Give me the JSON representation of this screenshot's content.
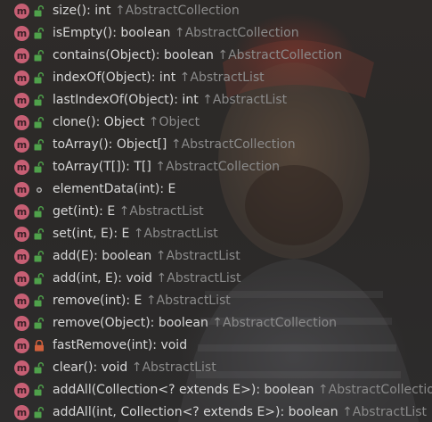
{
  "colors": {
    "method_icon": "#c75f74",
    "public_lock": "#4fa14b",
    "private_lock": "#d0603c",
    "text": "#d7d7d7",
    "origin_text": "#8a8a8a"
  },
  "members": [
    {
      "kind_letter": "m",
      "access": "public",
      "access_icon": "unlocked-icon",
      "signature": "size(): int",
      "origin": "↑AbstractCollection"
    },
    {
      "kind_letter": "m",
      "access": "public",
      "access_icon": "unlocked-icon",
      "signature": "isEmpty(): boolean",
      "origin": "↑AbstractCollection"
    },
    {
      "kind_letter": "m",
      "access": "public",
      "access_icon": "unlocked-icon",
      "signature": "contains(Object): boolean",
      "origin": "↑AbstractCollection"
    },
    {
      "kind_letter": "m",
      "access": "public",
      "access_icon": "unlocked-icon",
      "signature": "indexOf(Object): int",
      "origin": "↑AbstractList"
    },
    {
      "kind_letter": "m",
      "access": "public",
      "access_icon": "unlocked-icon",
      "signature": "lastIndexOf(Object): int",
      "origin": "↑AbstractList"
    },
    {
      "kind_letter": "m",
      "access": "public",
      "access_icon": "unlocked-icon",
      "signature": "clone(): Object",
      "origin": "↑Object"
    },
    {
      "kind_letter": "m",
      "access": "public",
      "access_icon": "unlocked-icon",
      "signature": "toArray(): Object[]",
      "origin": "↑AbstractCollection"
    },
    {
      "kind_letter": "m",
      "access": "public",
      "access_icon": "unlocked-icon",
      "signature": "toArray(T[]): T[]",
      "origin": "↑AbstractCollection"
    },
    {
      "kind_letter": "m",
      "access": "package",
      "access_icon": "package-dot-icon",
      "signature": "elementData(int): E",
      "origin": ""
    },
    {
      "kind_letter": "m",
      "access": "public",
      "access_icon": "unlocked-icon",
      "signature": "get(int): E",
      "origin": "↑AbstractList"
    },
    {
      "kind_letter": "m",
      "access": "public",
      "access_icon": "unlocked-icon",
      "signature": "set(int, E): E",
      "origin": "↑AbstractList"
    },
    {
      "kind_letter": "m",
      "access": "public",
      "access_icon": "unlocked-icon",
      "signature": "add(E): boolean",
      "origin": "↑AbstractList"
    },
    {
      "kind_letter": "m",
      "access": "public",
      "access_icon": "unlocked-icon",
      "signature": "add(int, E): void",
      "origin": "↑AbstractList"
    },
    {
      "kind_letter": "m",
      "access": "public",
      "access_icon": "unlocked-icon",
      "signature": "remove(int): E",
      "origin": "↑AbstractList"
    },
    {
      "kind_letter": "m",
      "access": "public",
      "access_icon": "unlocked-icon",
      "signature": "remove(Object): boolean",
      "origin": "↑AbstractCollection"
    },
    {
      "kind_letter": "m",
      "access": "private",
      "access_icon": "locked-icon",
      "signature": "fastRemove(int): void",
      "origin": ""
    },
    {
      "kind_letter": "m",
      "access": "public",
      "access_icon": "unlocked-icon",
      "signature": "clear(): void",
      "origin": "↑AbstractList"
    },
    {
      "kind_letter": "m",
      "access": "public",
      "access_icon": "unlocked-icon",
      "signature": "addAll(Collection<? extends E>): boolean",
      "origin": "↑AbstractCollection"
    },
    {
      "kind_letter": "m",
      "access": "public",
      "access_icon": "unlocked-icon",
      "signature": "addAll(int, Collection<? extends E>): boolean",
      "origin": "↑AbstractList"
    }
  ]
}
